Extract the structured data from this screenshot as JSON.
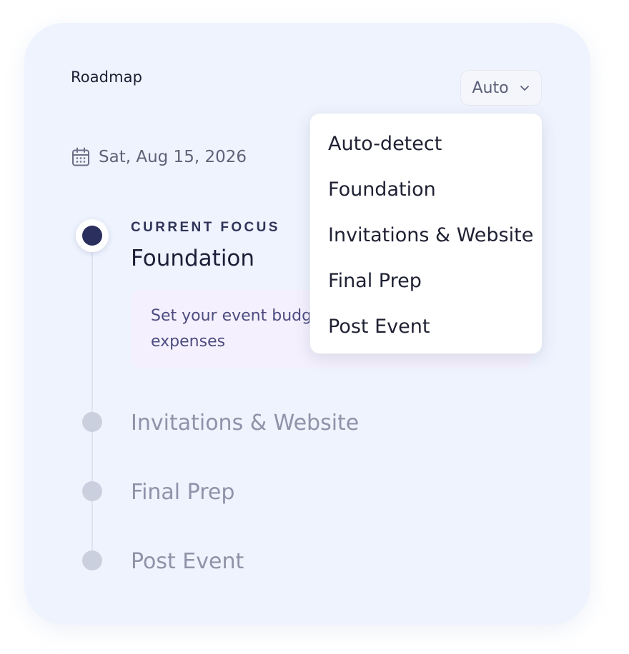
{
  "card": {
    "title": "Roadmap"
  },
  "mode_select": {
    "value": "Auto",
    "icon": "chevron-down-icon"
  },
  "date": {
    "icon": "calendar-icon",
    "text": "Sat, Aug 15, 2026"
  },
  "current": {
    "label": "CURRENT FOCUS",
    "title": "Foundation",
    "description": "Set your event budget and track your expenses"
  },
  "stages": [
    {
      "title": "Invitations & Website"
    },
    {
      "title": "Final Prep"
    },
    {
      "title": "Post Event"
    }
  ],
  "dropdown": {
    "options": [
      {
        "label": "Auto-detect"
      },
      {
        "label": "Foundation"
      },
      {
        "label": "Invitations & Website"
      },
      {
        "label": "Final Prep"
      },
      {
        "label": "Post Event"
      }
    ]
  },
  "colors": {
    "card_bg": "#eef3fe",
    "current_dot": "#2b2f5e",
    "future_dot": "#cbd0de",
    "description_bg": "#f4f0fd"
  }
}
